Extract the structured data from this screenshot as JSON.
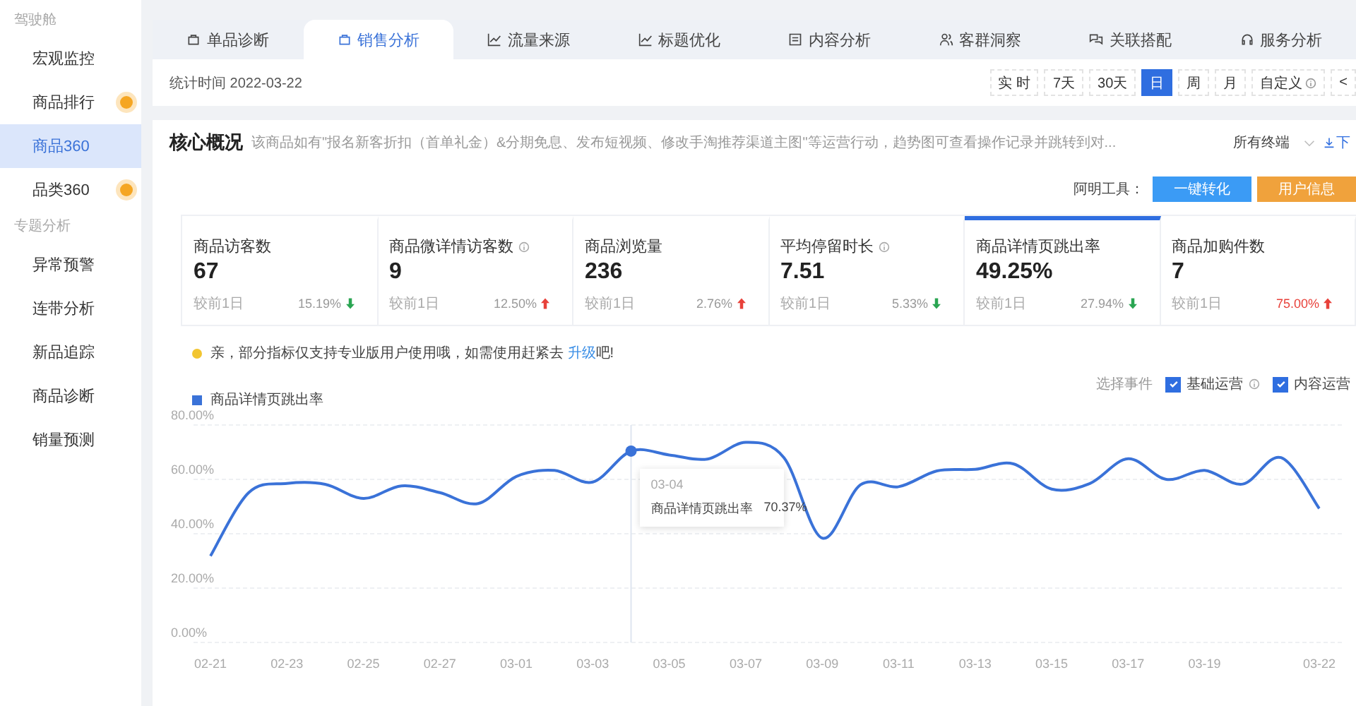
{
  "sidebar": {
    "sections": [
      {
        "title": "驾驶舱",
        "items": [
          {
            "label": "宏观监控",
            "selected": false,
            "badge": false
          },
          {
            "label": "商品排行",
            "selected": false,
            "badge": true
          },
          {
            "label": "商品360",
            "selected": true,
            "badge": false
          },
          {
            "label": "品类360",
            "selected": false,
            "badge": true
          }
        ]
      },
      {
        "title": "专题分析",
        "items": [
          {
            "label": "异常预警",
            "selected": false,
            "badge": false
          },
          {
            "label": "连带分析",
            "selected": false,
            "badge": false
          },
          {
            "label": "新品追踪",
            "selected": false,
            "badge": false
          },
          {
            "label": "商品诊断",
            "selected": false,
            "badge": false
          },
          {
            "label": "销量预测",
            "selected": false,
            "badge": false
          }
        ]
      }
    ]
  },
  "tabs": [
    {
      "label": "单品诊断",
      "kind": "bag",
      "selected": false
    },
    {
      "label": "销售分析",
      "kind": "bag",
      "selected": true
    },
    {
      "label": "流量来源",
      "kind": "chart",
      "selected": false
    },
    {
      "label": "标题优化",
      "kind": "chart",
      "selected": false
    },
    {
      "label": "内容分析",
      "kind": "doc",
      "selected": false
    },
    {
      "label": "客群洞察",
      "kind": "people",
      "selected": false
    },
    {
      "label": "关联搭配",
      "kind": "link",
      "selected": false
    },
    {
      "label": "服务分析",
      "kind": "headset",
      "selected": false
    }
  ],
  "date_bar": {
    "label": "统计时间 2022-03-22",
    "ranges": [
      {
        "label": "实 时",
        "selected": false,
        "info": false
      },
      {
        "label": "7天",
        "selected": false,
        "info": false
      },
      {
        "label": "30天",
        "selected": false,
        "info": false
      },
      {
        "label": "日",
        "selected": true,
        "info": false
      },
      {
        "label": "周",
        "selected": false,
        "info": false
      },
      {
        "label": "月",
        "selected": false,
        "info": false
      },
      {
        "label": "自定义",
        "selected": false,
        "info": true
      }
    ],
    "prev": "<"
  },
  "overview": {
    "title": "核心概况",
    "description": "该商品如有\"报名新客折扣（首单礼金）&分期免息、发布短视频、修改手淘推荐渠道主图\"等运营行动，趋势图可查看操作记录并跳转到对...",
    "terminal": "所有终端",
    "download": "下",
    "tools_label": "阿明工具：",
    "tools": [
      {
        "label": "一键转化",
        "color": "#3b9bf5"
      },
      {
        "label": "用户信息",
        "color": "#f0a23c"
      }
    ],
    "metrics": [
      {
        "label": "商品访客数",
        "info": false,
        "value": "67",
        "compare": "较前1日",
        "change": "15.19%",
        "rising": false,
        "alert": false,
        "selected": false
      },
      {
        "label": "商品微详情访客数",
        "info": true,
        "value": "9",
        "compare": "较前1日",
        "change": "12.50%",
        "rising": true,
        "alert": false,
        "selected": false
      },
      {
        "label": "商品浏览量",
        "info": false,
        "value": "236",
        "compare": "较前1日",
        "change": "2.76%",
        "rising": true,
        "alert": false,
        "selected": false
      },
      {
        "label": "平均停留时长",
        "info": true,
        "value": "7.51",
        "compare": "较前1日",
        "change": "5.33%",
        "rising": false,
        "alert": false,
        "selected": false
      },
      {
        "label": "商品详情页跳出率",
        "info": false,
        "value": "49.25%",
        "compare": "较前1日",
        "change": "27.94%",
        "rising": false,
        "alert": false,
        "selected": true
      },
      {
        "label": "商品加购件数",
        "info": false,
        "value": "7",
        "compare": "较前1日",
        "change": "75.00%",
        "rising": true,
        "alert": true,
        "selected": false
      }
    ],
    "notice": {
      "text": "亲，部分指标仅支持专业版用户使用哦，如需使用赶紧去",
      "link": "升级",
      "tail": "吧!"
    },
    "events": {
      "label": "选择事件",
      "options": [
        {
          "label": "基础运营",
          "checked": true,
          "info": true
        },
        {
          "label": "内容运营",
          "checked": true,
          "info": false
        }
      ]
    },
    "tooltip": {
      "date": "03-04",
      "series": "商品详情页跳出率",
      "value": "70.37%"
    },
    "chart_data": {
      "type": "line",
      "grid": true,
      "categories": [
        "02-21",
        null,
        "02-23",
        null,
        "02-25",
        null,
        "02-27",
        null,
        "03-01",
        null,
        "03-03",
        null,
        "03-05",
        null,
        "03-07",
        null,
        "03-09",
        null,
        "03-11",
        null,
        "03-13",
        null,
        "03-15",
        null,
        "03-17",
        null,
        "03-19",
        null,
        null,
        "03-22"
      ],
      "series": [
        {
          "name": "商品详情页跳出率",
          "color": "#3a72d8",
          "values": [
            31.8,
            55.1,
            58.5,
            58.2,
            53.0,
            57.6,
            55.1,
            51.1,
            61.1,
            63.3,
            59.0,
            70.4,
            69.0,
            67.5,
            73.6,
            68.0,
            38.4,
            58.0,
            57.3,
            63.1,
            63.7,
            65.7,
            56.4,
            58.5,
            67.6,
            60.0,
            63.3,
            58.3,
            68.0,
            49.3
          ]
        }
      ],
      "ylim": [
        0,
        80
      ],
      "yticks": [
        {
          "value": 0,
          "label": "0.00%"
        },
        {
          "value": 20,
          "label": "20.00%"
        },
        {
          "value": 40,
          "label": "40.00%"
        },
        {
          "value": 60,
          "label": "60.00%"
        },
        {
          "value": 80,
          "label": "80.00%"
        }
      ]
    }
  }
}
